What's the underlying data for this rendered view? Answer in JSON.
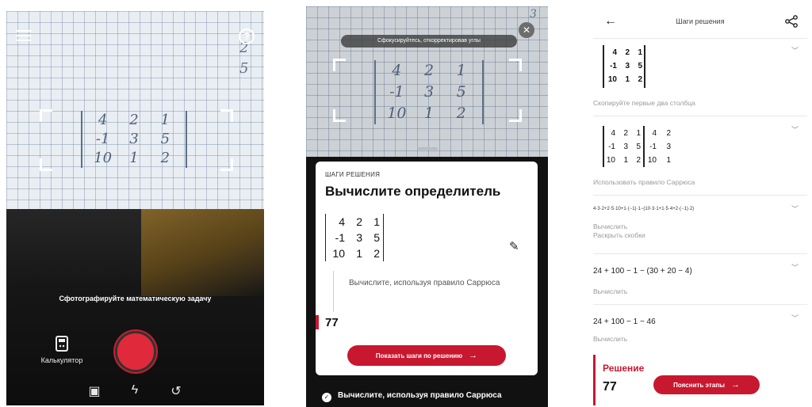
{
  "camera": {
    "bg_numbers": [
      "2",
      "5"
    ],
    "matrix": [
      [
        "4",
        "2",
        "1"
      ],
      [
        "-1",
        "3",
        "5"
      ],
      [
        "10",
        "1",
        "2"
      ]
    ],
    "prompt": "Сфотографируйте математическую задачу",
    "calculator_label": "Калькулятор"
  },
  "sheet": {
    "tip": "Сфокусируйтесь, откорректировав углы",
    "photo_matrix": [
      [
        "4",
        "2",
        "1"
      ],
      [
        "-1",
        "3",
        "5"
      ],
      [
        "10",
        "1",
        "2"
      ]
    ],
    "kicker": "ШАГИ РЕШЕНИЯ",
    "title": "Вычислите определитель",
    "matrix": [
      [
        "4",
        "2",
        "1"
      ],
      [
        "-1",
        "3",
        "5"
      ],
      [
        "10",
        "1",
        "2"
      ]
    ],
    "step_text": "Вычислите, используя правило Саррюса",
    "result": "77",
    "show_steps_button": "Показать шаги по решению",
    "footer_text": "Вычислите, используя правило Саррюса",
    "top_number": "3"
  },
  "steps": {
    "title": "Шаги решения",
    "step1": {
      "matrix": [
        [
          "4",
          "2",
          "1"
        ],
        [
          "-1",
          "3",
          "5"
        ],
        [
          "10",
          "1",
          "2"
        ]
      ],
      "caption": "Скопируйте первые два столбца"
    },
    "step2": {
      "matrix": [
        [
          "4",
          "2",
          "1",
          "4",
          "2"
        ],
        [
          "-1",
          "3",
          "5",
          "-1",
          "3"
        ],
        [
          "10",
          "1",
          "2",
          "10",
          "1"
        ]
      ],
      "caption": "Использовать правило Саррюса"
    },
    "step3": {
      "expr": "4·3·2+2·5·10+1·(−1)·1−(10·3·1+1·5·4+2·(−1)·2)",
      "caption1": "Вычислить",
      "caption2": "Раскрыть скобки"
    },
    "step4": {
      "expr": "24 + 100 − 1 − (30 + 20 − 4)",
      "caption": "Вычислить"
    },
    "step5": {
      "expr": "24 + 100 − 1 − 46",
      "caption": "Вычислить"
    },
    "solution_label": "Решение",
    "solution_value": "77",
    "explain_button": "Пояснить этапы"
  },
  "colors": {
    "accent": "#c8182f",
    "shutter": "#e02a3c"
  }
}
